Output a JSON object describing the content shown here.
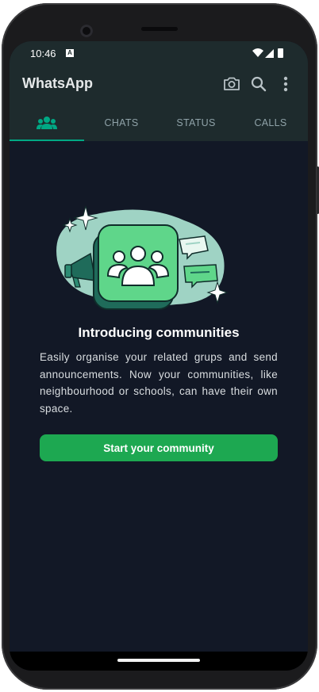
{
  "status_bar": {
    "time": "10:46",
    "notification_letter": "A",
    "icons": [
      "wifi-icon",
      "signal-icon",
      "battery-icon"
    ]
  },
  "app_bar": {
    "title": "WhatsApp",
    "icons": [
      "camera-icon",
      "search-icon",
      "more-vert-icon"
    ]
  },
  "tabs": [
    {
      "label": "",
      "icon": "communities-icon",
      "active": true
    },
    {
      "label": "CHATS",
      "active": false
    },
    {
      "label": "STATUS",
      "active": false
    },
    {
      "label": "CALLS",
      "active": false
    }
  ],
  "main": {
    "headline": "Introducing communities",
    "description": "Easily organise your related grups and send announcements. Now your communities, like neighbourhood or schools, can have their own space.",
    "cta_label": "Start your community"
  },
  "colors": {
    "app_bar_bg": "#1e2b2d",
    "screen_bg": "#121826",
    "accent": "#00a884",
    "button_bg": "#1da851",
    "illustration_green": "#5fd68a"
  }
}
